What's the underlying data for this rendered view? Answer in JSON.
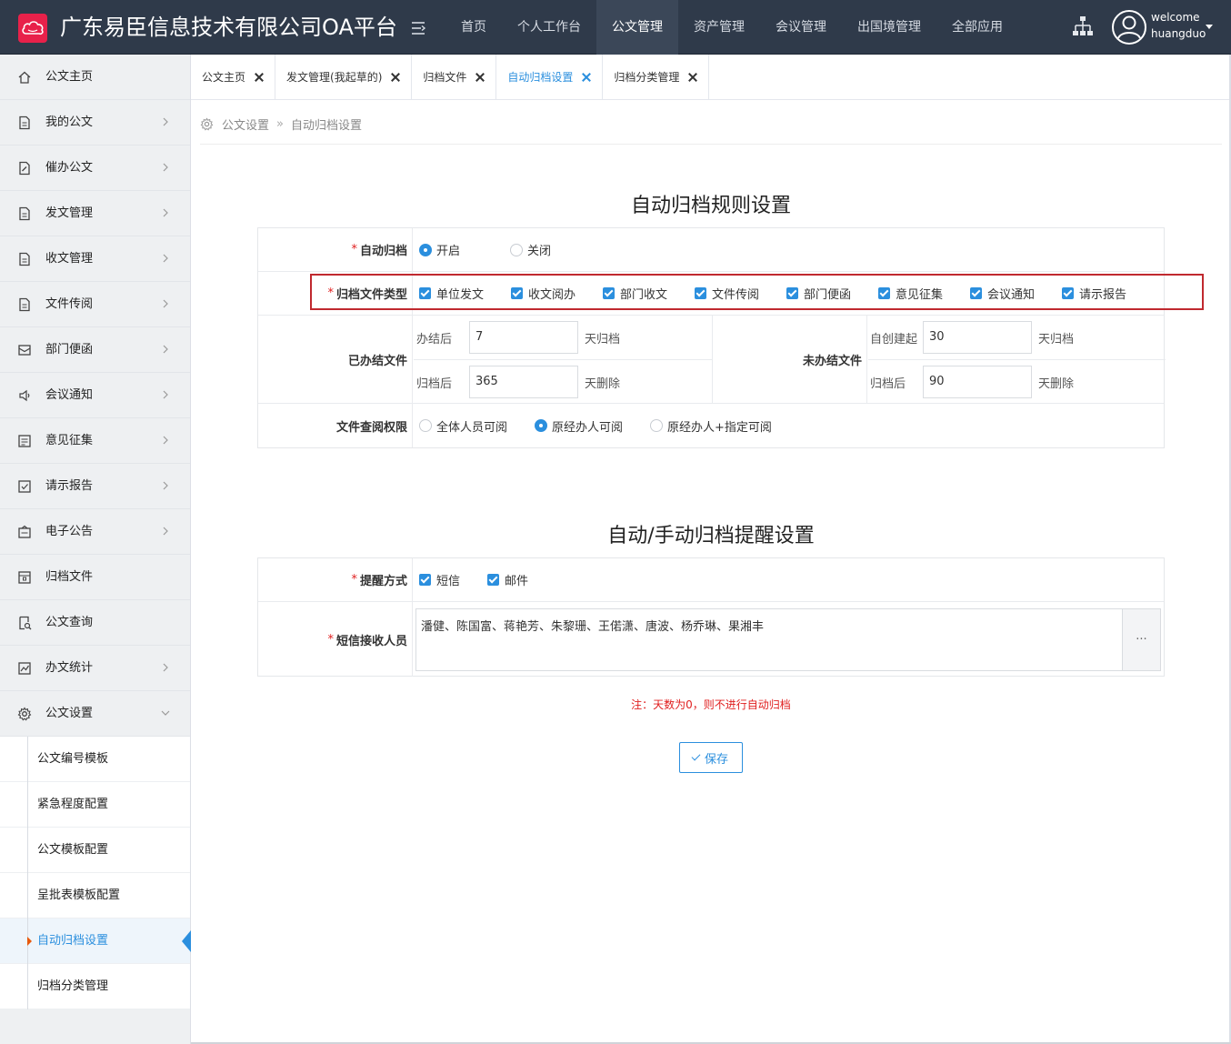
{
  "header": {
    "title": "广东易臣信息技术有限公司OA平台",
    "nav": [
      "首页",
      "个人工作台",
      "公文管理",
      "资产管理",
      "会议管理",
      "出国境管理",
      "全部应用"
    ],
    "nav_active": "公文管理",
    "welcome": "welcome",
    "username": "huangduo"
  },
  "colors": {
    "topbar": "#2f3a4a",
    "accent": "#2b8fde",
    "logo": "#e8214a",
    "required": "#e02020",
    "highlight_box": "#c0292f"
  },
  "sidebar": {
    "items": [
      {
        "label": "公文主页",
        "icon": "home-icon"
      },
      {
        "label": "我的公文",
        "icon": "document-icon"
      },
      {
        "label": "催办公文",
        "icon": "edit-document-icon"
      },
      {
        "label": "发文管理",
        "icon": "document-icon"
      },
      {
        "label": "收文管理",
        "icon": "document-icon"
      },
      {
        "label": "文件传阅",
        "icon": "document-icon"
      },
      {
        "label": "部门便函",
        "icon": "mail-icon"
      },
      {
        "label": "会议通知",
        "icon": "speaker-icon"
      },
      {
        "label": "意见征集",
        "icon": "comment-icon"
      },
      {
        "label": "请示报告",
        "icon": "report-icon"
      },
      {
        "label": "电子公告",
        "icon": "bulletin-icon"
      },
      {
        "label": "归档文件",
        "icon": "archive-icon"
      },
      {
        "label": "公文查询",
        "icon": "search-document-icon"
      },
      {
        "label": "办文统计",
        "icon": "chart-icon"
      },
      {
        "label": "公文设置",
        "icon": "gear-icon"
      }
    ],
    "subitems": [
      "公文编号模板",
      "紧急程度配置",
      "公文模板配置",
      "呈批表模板配置",
      "自动归档设置",
      "归档分类管理"
    ],
    "active_subitem": "自动归档设置"
  },
  "tabs": [
    "公文主页",
    "发文管理(我起草的)",
    "归档文件",
    "自动归档设置",
    "归档分类管理"
  ],
  "active_tab": "自动归档设置",
  "breadcrumb": {
    "parent": "公文设置",
    "sep": "»",
    "current": "自动归档设置"
  },
  "section1": {
    "title": "自动归档规则设置",
    "auto_archive": {
      "label": "自动归档",
      "options": [
        "开启",
        "关闭"
      ],
      "selected": "开启"
    },
    "file_types": {
      "label": "归档文件类型",
      "options": [
        "单位发文",
        "收文阅办",
        "部门收文",
        "文件传阅",
        "部门便函",
        "意见征集",
        "会议通知",
        "请示报告"
      ],
      "checked": [
        "单位发文",
        "收文阅办",
        "部门收文",
        "文件传阅",
        "部门便函",
        "意见征集",
        "会议通知",
        "请示报告"
      ]
    },
    "completed": {
      "label": "已办结文件",
      "after_done_label": "办结后",
      "after_done_value": "7",
      "after_done_unit": "天归档",
      "after_archive_label": "归档后",
      "after_archive_value": "365",
      "after_archive_unit": "天删除"
    },
    "uncompleted": {
      "label": "未办结文件",
      "since_created_label": "自创建起",
      "since_created_value": "30",
      "since_created_unit": "天归档",
      "after_archive_label": "归档后",
      "after_archive_value": "90",
      "after_archive_unit": "天删除"
    },
    "permission": {
      "label": "文件查阅权限",
      "options": [
        "全体人员可阅",
        "原经办人可阅",
        "原经办人+指定可阅"
      ],
      "selected": "原经办人可阅"
    }
  },
  "section2": {
    "title": "自动/手动归档提醒设置",
    "method": {
      "label": "提醒方式",
      "options": [
        "短信",
        "邮件"
      ],
      "checked": [
        "短信",
        "邮件"
      ]
    },
    "recipients": {
      "label": "短信接收人员",
      "value": "潘健、陈国富、蒋艳芳、朱黎珊、王偌潇、唐波、杨乔琳、果湘丰",
      "picker_label": "···"
    }
  },
  "required_mark": "*",
  "note": "注：天数为0，则不进行自动归档",
  "save_label": "保存"
}
